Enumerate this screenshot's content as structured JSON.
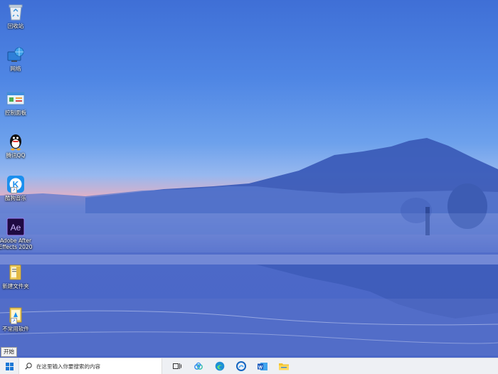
{
  "desktop": {
    "icons": [
      {
        "name": "recycle-bin",
        "label": "回收站",
        "icon": "recycle-bin-icon"
      },
      {
        "name": "network",
        "label": "网络",
        "icon": "network-globe-icon"
      },
      {
        "name": "control-panel",
        "label": "控制面板",
        "icon": "control-panel-icon"
      },
      {
        "name": "tencent-qq",
        "label": "腾讯QQ",
        "icon": "qq-penguin-icon"
      },
      {
        "name": "kugou-music",
        "label": "酷狗音乐",
        "icon": "kugou-k-icon"
      },
      {
        "name": "adobe-after-effects",
        "label": "Adobe After\nEffects 2020",
        "icon": "after-effects-icon"
      },
      {
        "name": "new-folder",
        "label": "新建文件夹",
        "icon": "folder-icon"
      },
      {
        "name": "unused-software",
        "label": "不常用软件",
        "icon": "folder-shortcut-icon"
      }
    ]
  },
  "tooltip": {
    "text": "开始"
  },
  "taskbar": {
    "search_placeholder": "在这里输入你要搜索的内容",
    "pinned": [
      "task-view-icon",
      "baidu-netdisk-icon",
      "edge-icon",
      "edge-beta-icon",
      "word-icon",
      "file-explorer-icon"
    ]
  },
  "colors": {
    "taskbar_bg": "#eef0f4",
    "accent": "#1b78d6"
  }
}
